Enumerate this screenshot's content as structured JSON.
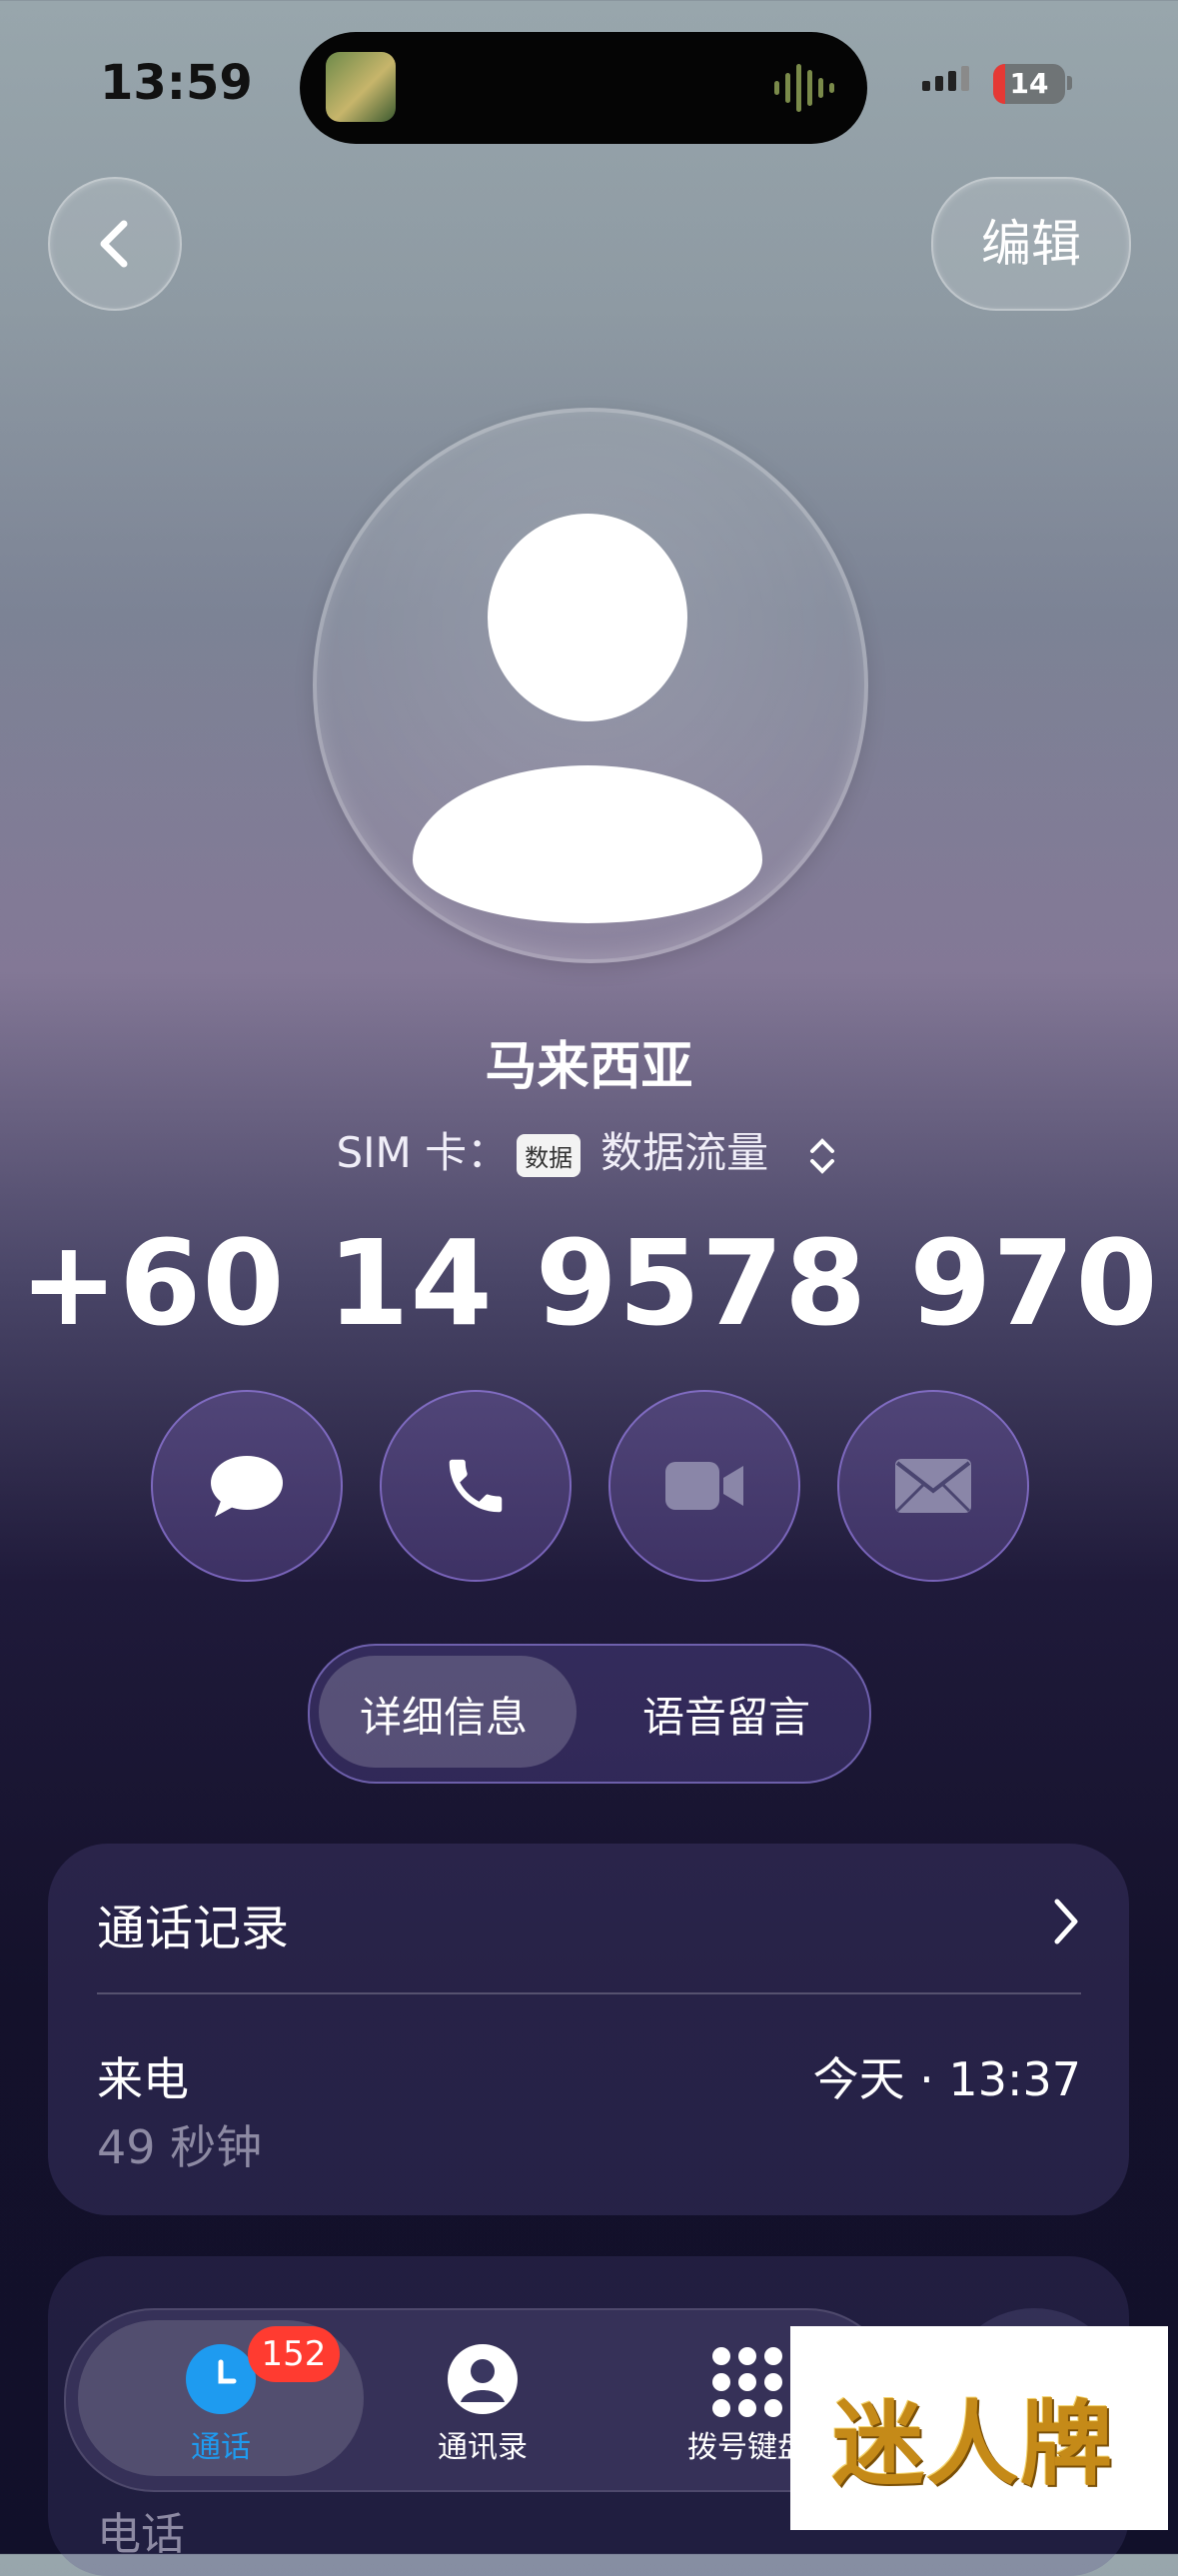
{
  "status_bar": {
    "time": "13:59",
    "battery": "14"
  },
  "nav": {
    "edit_label": "编辑"
  },
  "contact": {
    "name": "马来西亚",
    "sim_label": "SIM 卡：",
    "sim_tag": "数据",
    "sim_value": "数据流量",
    "phone": "+60 14 9578 970"
  },
  "actions": [
    "message",
    "call",
    "video",
    "mail"
  ],
  "segmented": {
    "tabs": [
      "详细信息",
      "语音留言"
    ],
    "selected": "详细信息"
  },
  "call_log": {
    "title": "通话记录",
    "entries": [
      {
        "type": "来电",
        "time": "今天 · 13:37",
        "duration": "49 秒钟"
      }
    ]
  },
  "next_section": {
    "label": "电话"
  },
  "tab_bar": {
    "tabs": [
      {
        "label": "通话",
        "badge": "152",
        "active": true
      },
      {
        "label": "通讯录"
      },
      {
        "label": "拨号键盘"
      }
    ]
  },
  "watermark": {
    "text": "迷人牌"
  },
  "colors": {
    "accent": "#1e9bf0",
    "badge": "#ff3b30"
  }
}
